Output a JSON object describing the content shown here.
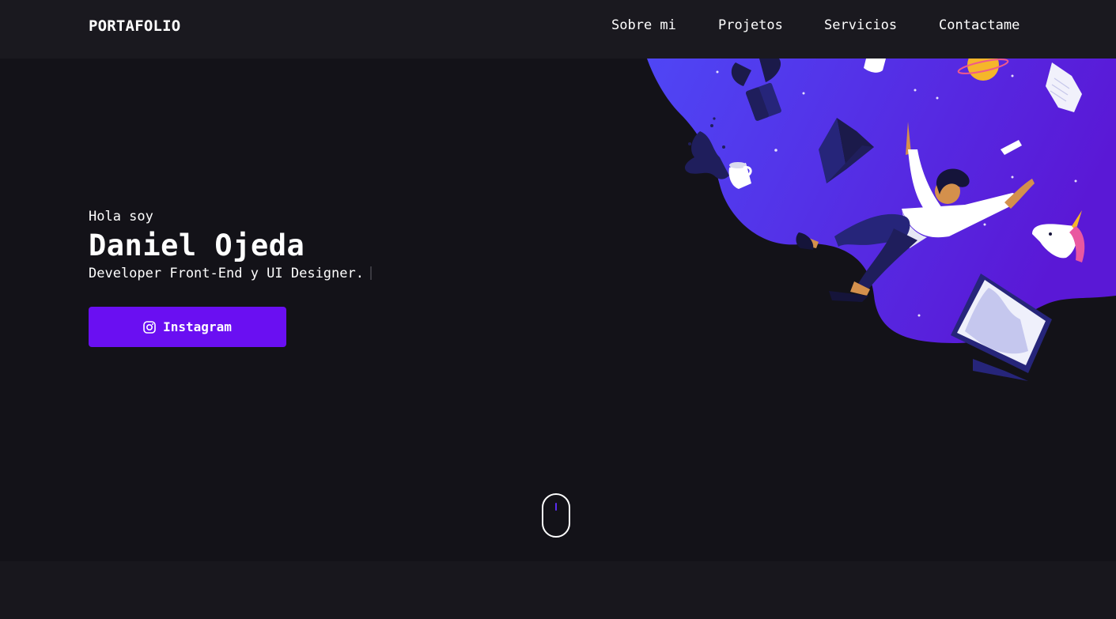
{
  "header": {
    "logo": "PORTAFOLIO",
    "nav": [
      {
        "label": "Sobre mi"
      },
      {
        "label": "Projetos"
      },
      {
        "label": "Servicios"
      },
      {
        "label": "Contactame"
      }
    ]
  },
  "hero": {
    "greeting": "Hola soy",
    "name": "Daniel Ojeda",
    "role": "Developer Front-End y UI Designer.",
    "button": {
      "label": "Instagram",
      "icon": "instagram-icon"
    },
    "illustration": "floating-developer-illustration"
  },
  "scroll_indicator": {
    "icon": "mouse-scroll-icon"
  },
  "colors": {
    "background": "#131218",
    "navbar": "#1a191f",
    "accent": "#6a0ff2",
    "illustration_gradient_start": "#4f46f5",
    "illustration_gradient_end": "#5a18d6"
  }
}
